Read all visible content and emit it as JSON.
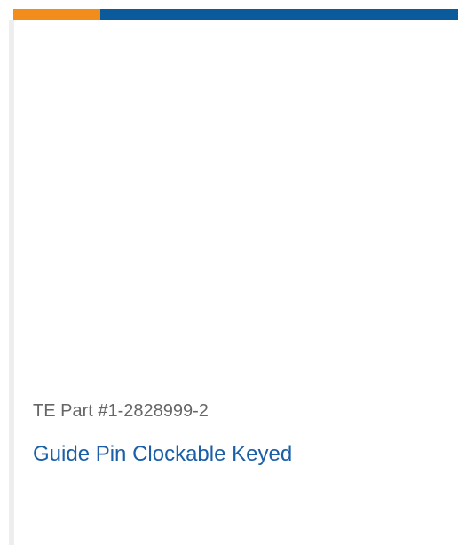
{
  "colors": {
    "accent": "#f28c1a",
    "brand": "#0a5a9c",
    "divider": "#eeeeee",
    "part_number_text": "#666666",
    "product_link": "#1a5fa8"
  },
  "product": {
    "part_number": "TE Part #1-2828999-2",
    "name": "Guide Pin Clockable Keyed"
  }
}
